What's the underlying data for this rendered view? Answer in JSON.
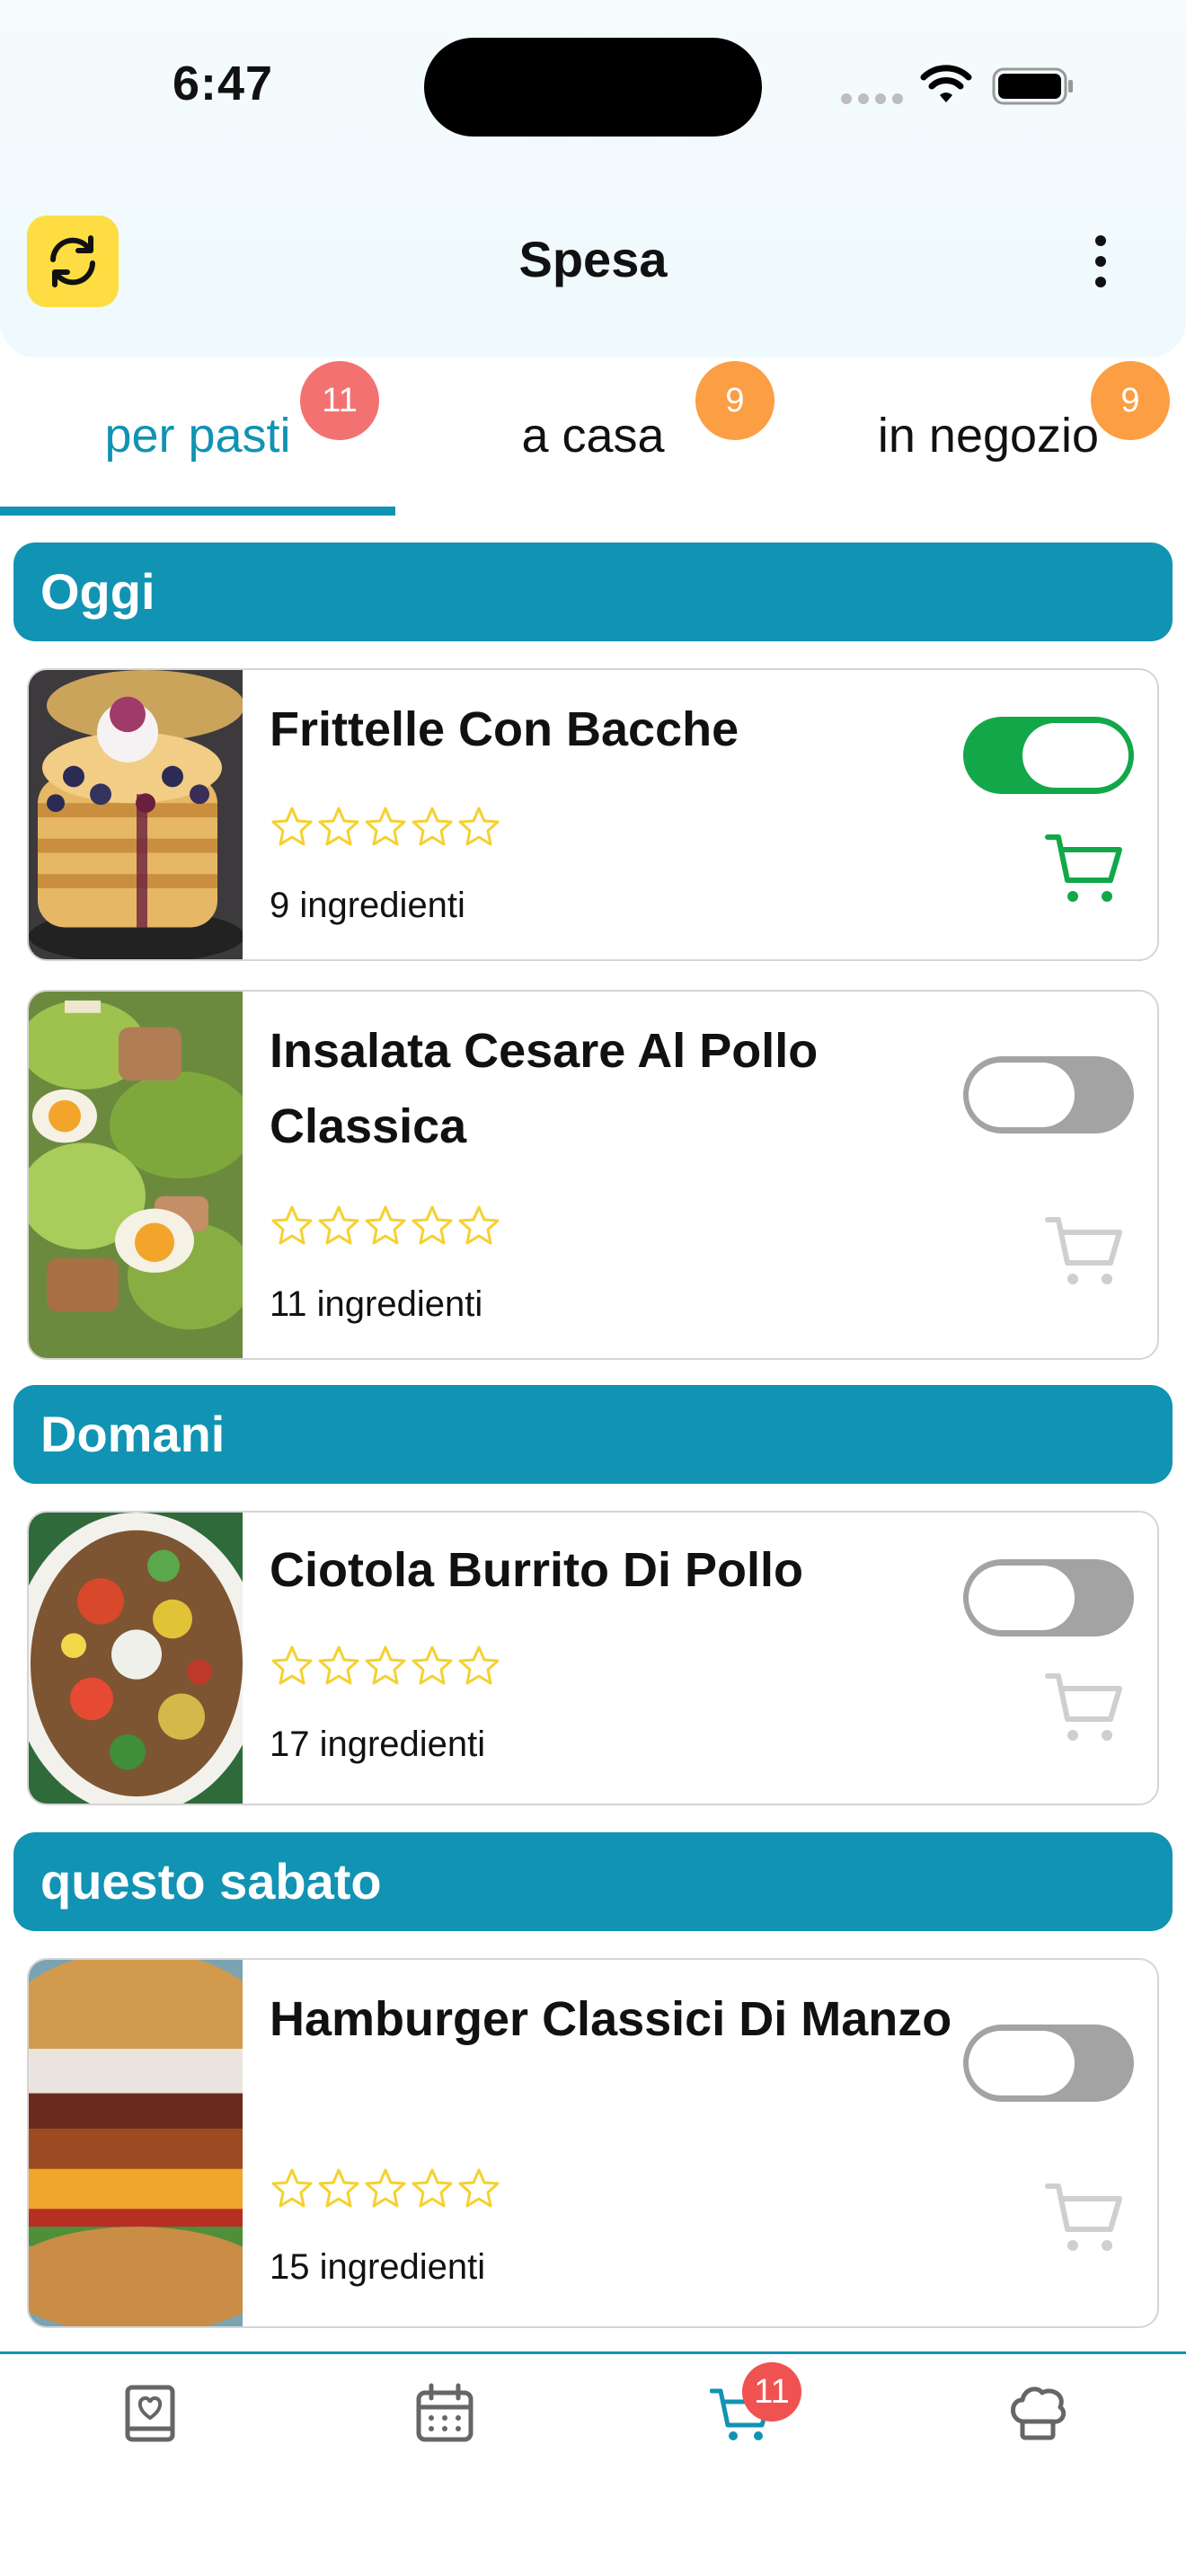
{
  "status_bar": {
    "time": "6:47"
  },
  "header": {
    "title": "Spesa",
    "refresh_icon": "refresh-icon",
    "menu_icon": "more-vertical-icon",
    "accent_color": "#fddd42"
  },
  "tabs": [
    {
      "label": "per pasti",
      "badge": "11",
      "badge_color": "#f27272",
      "active": true
    },
    {
      "label": "a casa",
      "badge": "9",
      "badge_color": "#fb9e44",
      "active": false
    },
    {
      "label": "in negozio",
      "badge": "9",
      "badge_color": "#fb9e44",
      "active": false
    }
  ],
  "sections": [
    {
      "label": "Oggi"
    },
    {
      "label": "Domani"
    },
    {
      "label": "questo sabato"
    }
  ],
  "meals": [
    {
      "title": "Frittelle Con Bacche",
      "rating": 0,
      "ingredients": "9 ingredienti",
      "toggle_on": true,
      "image_icon": "pancakes-photo"
    },
    {
      "title": "Insalata Cesare Al Pollo Classica",
      "rating": 0,
      "ingredients": "11 ingredienti",
      "toggle_on": false,
      "image_icon": "caesar-salad-photo"
    },
    {
      "title": "Ciotola Burrito Di Pollo",
      "rating": 0,
      "ingredients": "17 ingredienti",
      "toggle_on": false,
      "image_icon": "burrito-bowl-photo"
    },
    {
      "title": "Hamburger Classici Di Manzo",
      "rating": 0,
      "ingredients": "15 ingredienti",
      "toggle_on": false,
      "image_icon": "hamburger-photo"
    }
  ],
  "bottom_nav": {
    "items": [
      {
        "icon": "recipe-book-icon"
      },
      {
        "icon": "calendar-icon"
      },
      {
        "icon": "cart-icon",
        "active": true
      },
      {
        "icon": "chef-hat-icon"
      }
    ],
    "cart_badge": "11"
  },
  "colors": {
    "primary": "#1193b3",
    "toggle_on": "#12a84a",
    "toggle_off": "#a3a3a3",
    "star": "#f5d130"
  }
}
